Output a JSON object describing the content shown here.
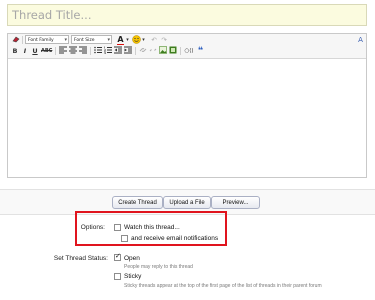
{
  "title": {
    "placeholder": "Thread Title...",
    "value": ""
  },
  "toolbar": {
    "font_family": "Font Family",
    "font_size": "Font Size",
    "icons": [
      "eraser-icon",
      "font-color-icon",
      "smiley-icon",
      "undo-icon",
      "redo-icon",
      "remove-format-icon",
      "bold-icon",
      "italic-icon",
      "underline-icon",
      "strikethrough-icon",
      "align-left-icon",
      "align-center-icon",
      "align-right-icon",
      "bullet-list-icon",
      "numbered-list-icon",
      "outdent-icon",
      "indent-icon",
      "link-icon",
      "unlink-icon",
      "image-icon",
      "media-icon",
      "code-icon",
      "quote-icon"
    ],
    "labels": {
      "bold": "B",
      "italic": "I",
      "underline": "U",
      "strike": "ABC",
      "font_color": "A",
      "quote": "❝",
      "code": "○⟨⟩",
      "toggle": "A"
    }
  },
  "actions": {
    "create": "Create Thread",
    "upload": "Upload a File",
    "preview": "Preview..."
  },
  "options": {
    "label": "Options:",
    "watch": {
      "label": "Watch this thread...",
      "checked": false
    },
    "email": {
      "label": "and receive email notifications",
      "checked": false
    }
  },
  "status": {
    "label": "Set Thread Status:",
    "open": {
      "label": "Open",
      "checked": true,
      "hint": "People may reply to this thread"
    },
    "sticky": {
      "label": "Sticky",
      "checked": false,
      "hint": "Sticky threads appear at the top of the first page of the list of threads in their parent forum"
    }
  },
  "colors": {
    "title_bg": "#fbfbdf",
    "highlight": "#e0141e",
    "button_border": "#aab0c4"
  }
}
